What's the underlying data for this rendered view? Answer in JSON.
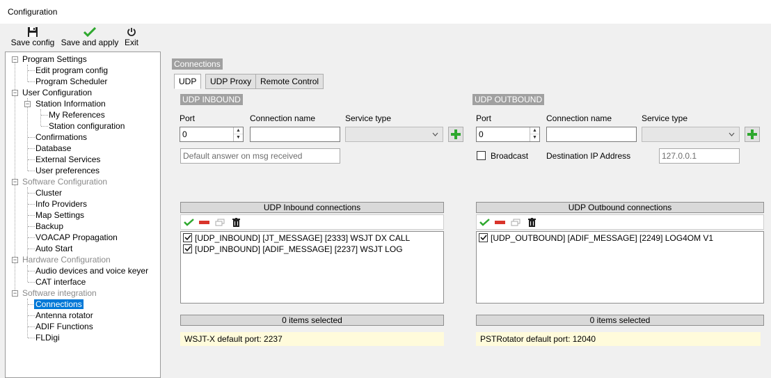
{
  "window": {
    "title": "Configuration"
  },
  "toolbar": {
    "save_config": "Save config",
    "save_and_apply": "Save and apply",
    "exit": "Exit"
  },
  "tree": {
    "program_settings": "Program Settings",
    "edit_program_config": "Edit program config",
    "program_scheduler": "Program Scheduler",
    "user_configuration": "User Configuration",
    "station_information": "Station Information",
    "my_references": "My References",
    "station_configuration": "Station configuration",
    "confirmations": "Confirmations",
    "database": "Database",
    "external_services": "External Services",
    "user_preferences": "User preferences",
    "software_configuration": "Software Configuration",
    "cluster": "Cluster",
    "info_providers": "Info Providers",
    "map_settings": "Map Settings",
    "backup": "Backup",
    "voacap_propagation": "VOACAP Propagation",
    "auto_start": "Auto Start",
    "hardware_configuration": "Hardware Configuration",
    "audio_devices": "Audio devices and voice keyer",
    "cat_interface": "CAT interface",
    "software_integration": "Software integration",
    "connections": "Connections",
    "antenna_rotator": "Antenna rotator",
    "adif_functions": "ADIF Functions",
    "fldigi": "FLDigi"
  },
  "panel": {
    "title": "Connections",
    "tabs": [
      "UDP",
      "UDP Proxy",
      "Remote Control"
    ]
  },
  "inbound": {
    "group_label": "UDP INBOUND",
    "port_label": "Port",
    "port_value": "0",
    "connection_name_label": "Connection name",
    "connection_name_value": "",
    "service_type_label": "Service type",
    "service_type_value": "",
    "default_answer_placeholder": "Default answer on msg received",
    "list_header": "UDP Inbound connections",
    "items": [
      "[UDP_INBOUND] [JT_MESSAGE] [2333] WSJT DX CALL",
      "[UDP_INBOUND] [ADIF_MESSAGE] [2237] WSJT LOG"
    ],
    "selected_count": "0 items selected",
    "note": "WSJT-X default port: 2237"
  },
  "outbound": {
    "group_label": "UDP OUTBOUND",
    "port_label": "Port",
    "port_value": "0",
    "connection_name_label": "Connection name",
    "connection_name_value": "",
    "service_type_label": "Service type",
    "service_type_value": "",
    "broadcast_label": "Broadcast",
    "destination_ip_label": "Destination IP Address",
    "destination_ip_value": "127.0.0.1",
    "list_header": "UDP Outbound connections",
    "items": [
      "[UDP_OUTBOUND] [ADIF_MESSAGE] [2249] LOG4OM V1"
    ],
    "selected_count": "0 items selected",
    "note": "PSTRotator default port: 12040"
  },
  "colors": {
    "accent_selection": "#0078d7",
    "group_label_bg": "#a0a0a0",
    "note_bg": "#fffbdb",
    "check_green": "#2ea82e",
    "minus_red": "#d9342b"
  }
}
